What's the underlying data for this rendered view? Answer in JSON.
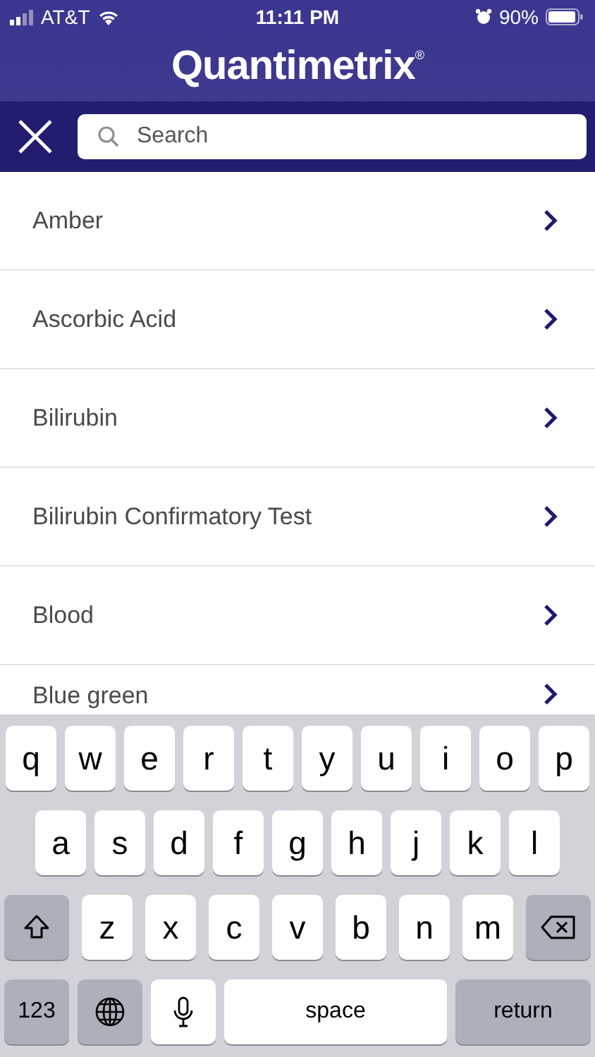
{
  "status_bar": {
    "carrier": "AT&T",
    "time": "11:11 PM",
    "battery": "90%"
  },
  "header": {
    "title": "Quantimetrix",
    "mark": "®"
  },
  "search": {
    "placeholder": "Search"
  },
  "items": [
    {
      "label": "Amber"
    },
    {
      "label": "Ascorbic Acid"
    },
    {
      "label": "Bilirubin"
    },
    {
      "label": "Bilirubin Confirmatory Test"
    },
    {
      "label": "Blood"
    },
    {
      "label": "Blue green"
    }
  ],
  "keyboard": [
    [
      {
        "kind": "letter",
        "label": "q"
      },
      {
        "kind": "letter",
        "label": "w"
      },
      {
        "kind": "letter",
        "label": "e"
      },
      {
        "kind": "letter",
        "label": "r"
      },
      {
        "kind": "letter",
        "label": "t"
      },
      {
        "kind": "letter",
        "label": "y"
      },
      {
        "kind": "letter",
        "label": "u"
      },
      {
        "kind": "letter",
        "label": "i"
      },
      {
        "kind": "letter",
        "label": "o"
      },
      {
        "kind": "letter",
        "label": "p"
      }
    ],
    [
      {
        "kind": "letter",
        "label": "a"
      },
      {
        "kind": "letter",
        "label": "s"
      },
      {
        "kind": "letter",
        "label": "d"
      },
      {
        "kind": "letter",
        "label": "f"
      },
      {
        "kind": "letter",
        "label": "g"
      },
      {
        "kind": "letter",
        "label": "h"
      },
      {
        "kind": "letter",
        "label": "j"
      },
      {
        "kind": "letter",
        "label": "k"
      },
      {
        "kind": "letter",
        "label": "l"
      }
    ],
    [
      {
        "kind": "shift"
      },
      {
        "kind": "letter",
        "label": "z"
      },
      {
        "kind": "letter",
        "label": "x"
      },
      {
        "kind": "letter",
        "label": "c"
      },
      {
        "kind": "letter",
        "label": "v"
      },
      {
        "kind": "letter",
        "label": "b"
      },
      {
        "kind": "letter",
        "label": "n"
      },
      {
        "kind": "letter",
        "label": "m"
      },
      {
        "kind": "backspace"
      }
    ],
    [
      {
        "kind": "mode",
        "label": "123"
      },
      {
        "kind": "globe"
      },
      {
        "kind": "mic"
      },
      {
        "kind": "space",
        "label": "space"
      },
      {
        "kind": "return",
        "label": "return"
      }
    ]
  ]
}
